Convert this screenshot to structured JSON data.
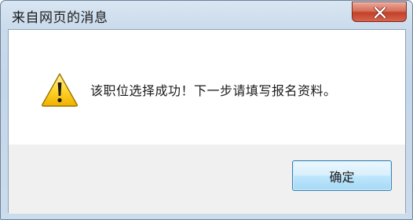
{
  "window": {
    "title": "来自网页的消息"
  },
  "dialog": {
    "icon": "warning-icon",
    "message": "该职位选择成功！下一步请填写报名资料。"
  },
  "buttons": {
    "ok_label": "确定"
  },
  "title_controls": {
    "close_icon": "close-icon"
  }
}
